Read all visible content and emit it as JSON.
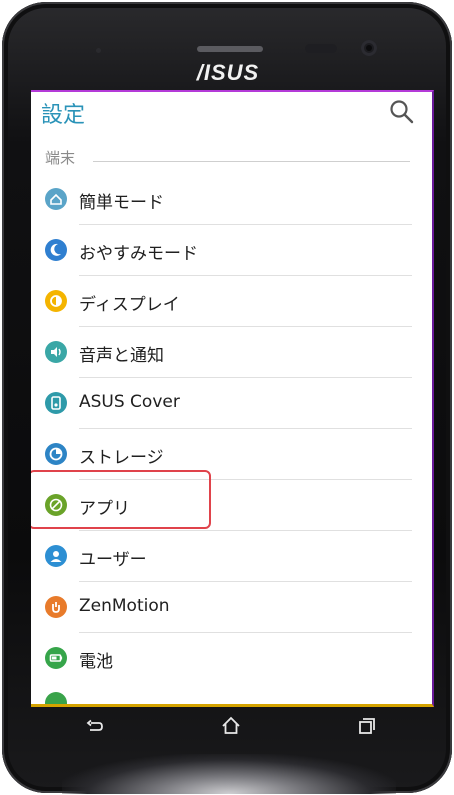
{
  "device": {
    "brand_logo": "/ISUS"
  },
  "appbar": {
    "title": "設定",
    "search_icon": "search-icon"
  },
  "section": {
    "label": "端末"
  },
  "menu": {
    "items": [
      {
        "label": "簡単モード",
        "icon": "easy-mode-icon",
        "color": "#5aa4c8"
      },
      {
        "label": "おやすみモード",
        "icon": "moon-icon",
        "color": "#2f7fd0"
      },
      {
        "label": "ディスプレイ",
        "icon": "display-icon",
        "color": "#f4b400"
      },
      {
        "label": "音声と通知",
        "icon": "sound-icon",
        "color": "#3aa7a6"
      },
      {
        "label": "ASUS Cover",
        "icon": "asus-cover-icon",
        "color": "#2e9aa9"
      },
      {
        "label": "ストレージ",
        "icon": "storage-icon",
        "color": "#2d84c5"
      },
      {
        "label": "アプリ",
        "icon": "apps-icon",
        "color": "#6aa329"
      },
      {
        "label": "ユーザー",
        "icon": "user-icon",
        "color": "#2d8fd3"
      },
      {
        "label": "ZenMotion",
        "icon": "zenmotion-icon",
        "color": "#e87b2b"
      },
      {
        "label": "電池",
        "icon": "battery-icon",
        "color": "#36a54a"
      }
    ],
    "highlighted_item": "アプリ"
  },
  "navbar": {
    "back": "back-icon",
    "home": "home-icon",
    "recents": "recents-icon"
  }
}
